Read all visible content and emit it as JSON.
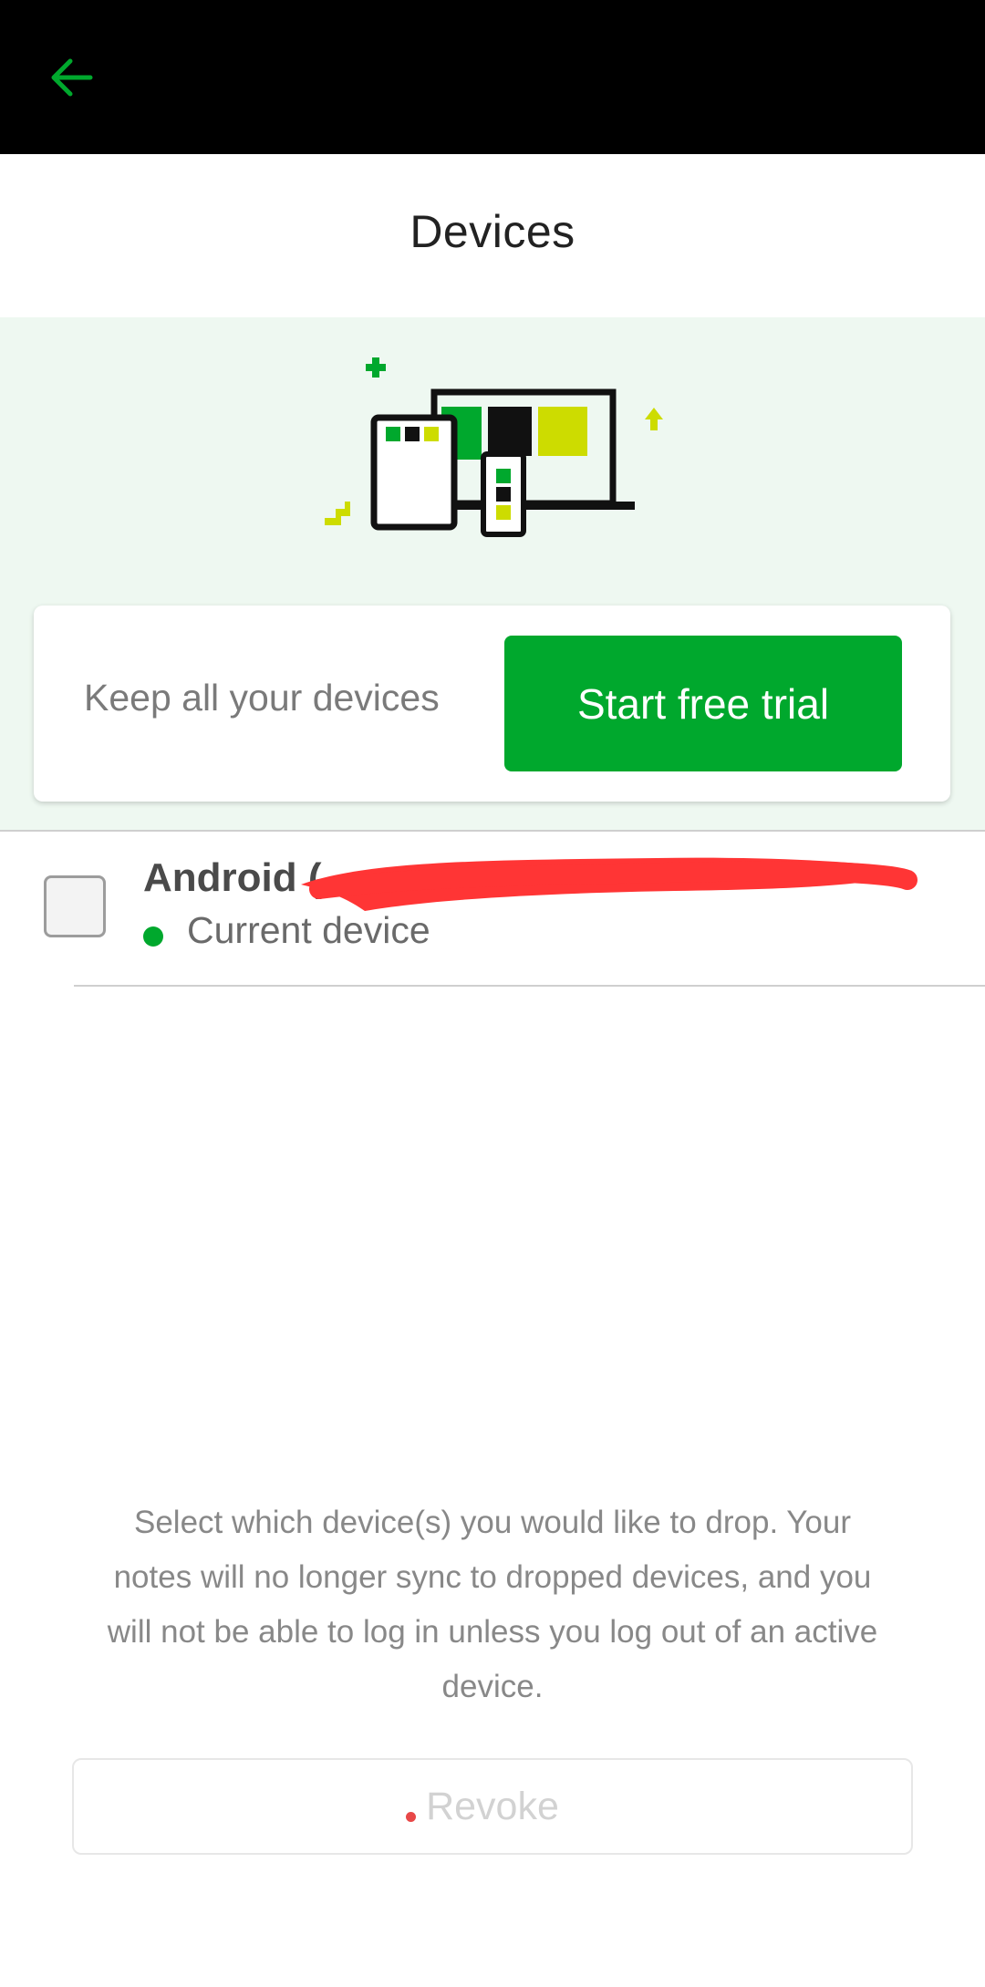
{
  "app": {
    "title": "Devices"
  },
  "promo": {
    "text": "Keep all your devices",
    "button_label": "Start free trial"
  },
  "devices": [
    {
      "name": "Android (",
      "status": "Current device"
    }
  ],
  "footer": {
    "instructions": "Select which device(s) you would like to drop. Your notes will no longer sync to dropped devices, and you will not be able to log in unless you log out of an active device.",
    "revoke_label": "Revoke"
  },
  "icons": {
    "back": "arrow-left-icon",
    "illustration": "devices-illustration-icon"
  },
  "colors": {
    "accent": "#00a82d",
    "accent_yellow": "#cddc00",
    "top_bar": "#000000",
    "promo_background": "#eef8f1",
    "redaction": "#ff3535"
  }
}
